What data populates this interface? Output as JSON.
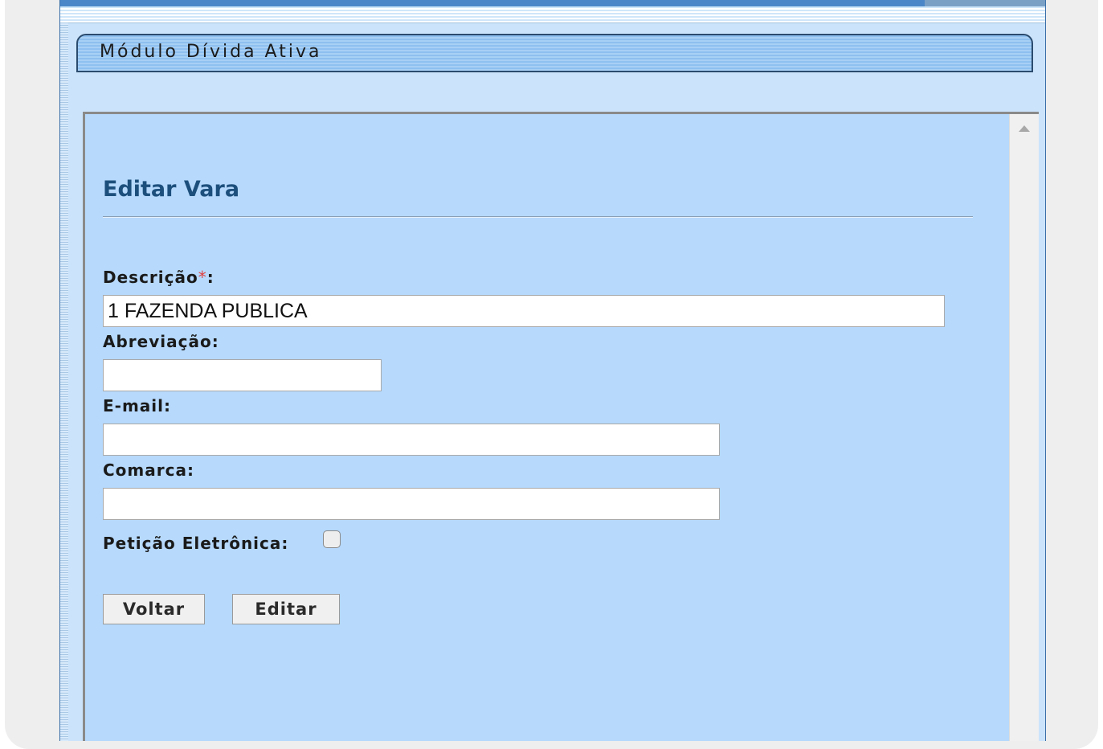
{
  "module": {
    "title": "Módulo Dívida Ativa"
  },
  "form": {
    "title": "Editar Vara",
    "fields": {
      "descricao": {
        "label": "Descrição",
        "required_mark": "*",
        "suffix": ":",
        "value": "1 FAZENDA PUBLICA"
      },
      "abreviacao": {
        "label": "Abreviação:",
        "value": ""
      },
      "email": {
        "label": "E-mail:",
        "value": ""
      },
      "comarca": {
        "label": "Comarca:",
        "value": ""
      },
      "peticao": {
        "label": "Petição Eletrônica:",
        "checked": false
      }
    },
    "buttons": {
      "back": "Voltar",
      "edit": "Editar"
    }
  },
  "colors": {
    "panel_bg": "#b6d9fc",
    "title_color": "#1d4f7c",
    "required_color": "#e04040"
  },
  "icons": {
    "scroll_up": "triangle-up-icon"
  }
}
